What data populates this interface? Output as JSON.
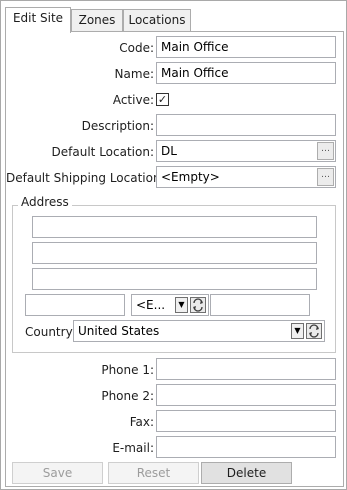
{
  "tabs": [
    {
      "label": "Edit Site",
      "active": true
    },
    {
      "label": "Zones",
      "active": false
    },
    {
      "label": "Locations",
      "active": false
    }
  ],
  "form": {
    "code": {
      "label": "Code:",
      "value": "Main Office"
    },
    "name": {
      "label": "Name:",
      "value": "Main Office"
    },
    "active": {
      "label": "Active:",
      "checked": true,
      "mark": "✓"
    },
    "description": {
      "label": "Description:",
      "value": ""
    },
    "default_location": {
      "label": "Default Location:",
      "value": "DL"
    },
    "default_shipping_location": {
      "label": "Default Shipping Location:",
      "value": "<Empty>"
    }
  },
  "address": {
    "title": "Address",
    "line1": "",
    "line2": "",
    "line3": "",
    "city": "",
    "state": "<E...",
    "zip": "",
    "country_label": "Country:",
    "country": "United States"
  },
  "contact": {
    "phone1": {
      "label": "Phone 1:",
      "value": ""
    },
    "phone2": {
      "label": "Phone 2:",
      "value": ""
    },
    "fax": {
      "label": "Fax:",
      "value": ""
    },
    "email": {
      "label": "E-mail:",
      "value": ""
    }
  },
  "buttons": {
    "save": {
      "label": "Save",
      "enabled": false
    },
    "reset": {
      "label": "Reset",
      "enabled": false
    },
    "delete": {
      "label": "Delete",
      "enabled": true
    }
  },
  "icons": {
    "ellipsis": "…",
    "dropdown": "▼",
    "refresh": "refresh-icon"
  }
}
